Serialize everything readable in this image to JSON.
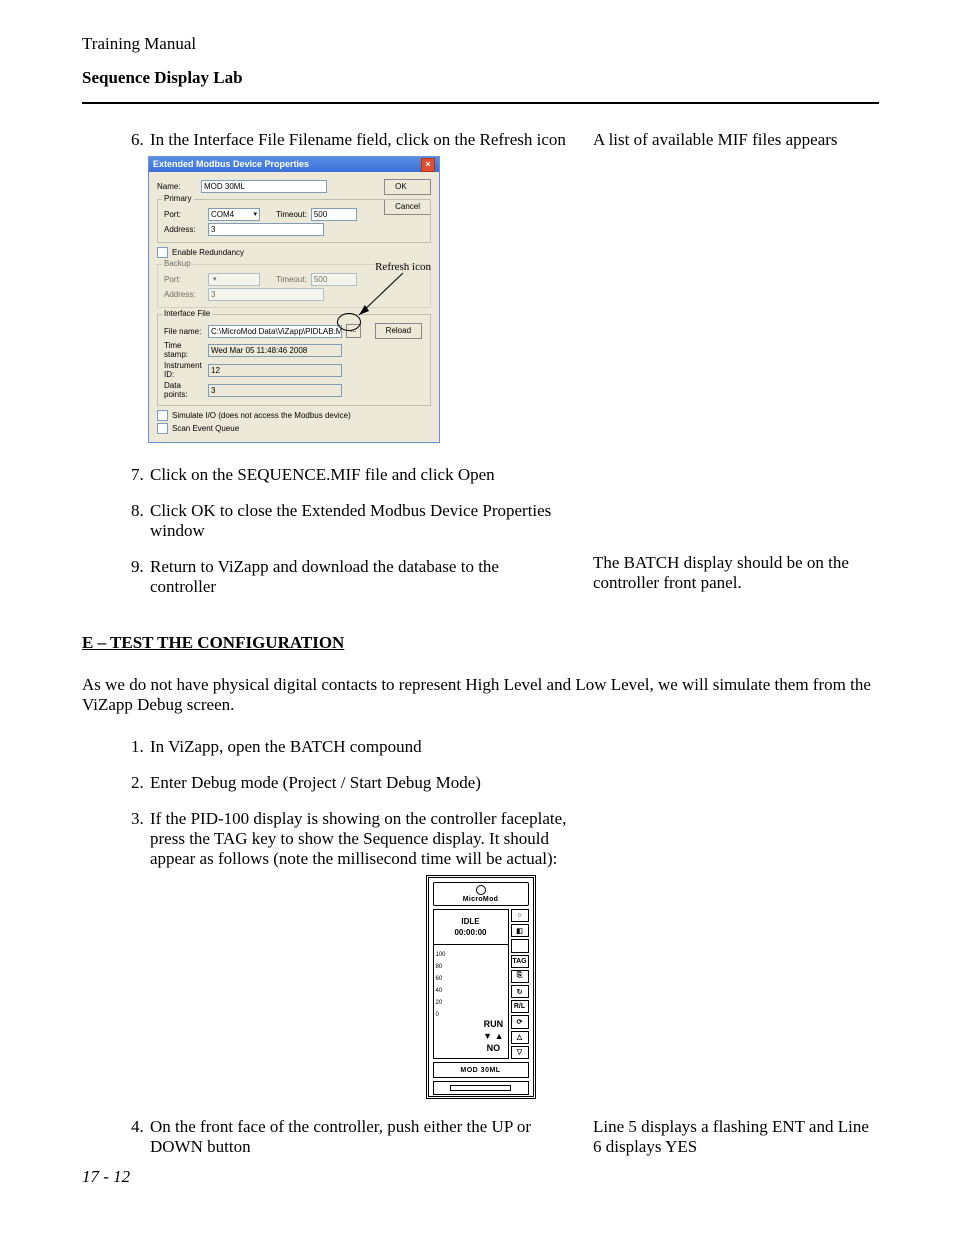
{
  "header": {
    "top": "Training Manual",
    "sub": "Sequence Display Lab"
  },
  "stepsA": {
    "start": 6,
    "items": [
      {
        "t": "In the Interface File Filename field, click on the Refresh icon",
        "r": "A list of available MIF files appears"
      }
    ]
  },
  "dlg": {
    "title": "Extended Modbus Device Properties",
    "ok": "OK",
    "cancel": "Cancel",
    "reload": "Reload",
    "name_lbl": "Name:",
    "name_val": "MOD 30ML",
    "primary": "Primary",
    "port_lbl": "Port:",
    "port_val": "COM4",
    "timeout_lbl": "Timeout:",
    "timeout_val": "500",
    "addr_lbl": "Address:",
    "addr_val": "3",
    "enable_red": "Enable Redundancy",
    "backup": "Backup",
    "backup_port": "",
    "backup_timeout": "500",
    "backup_addr": "3",
    "iface": "Interface File",
    "file_lbl": "File name:",
    "file_val": "C:\\MicroMod Data\\ViZapp\\PIDLAB.MIF",
    "ts_lbl": "Time stamp:",
    "ts_val": "Wed Mar 05 11:48:46 2008",
    "iid_lbl": "Instrument ID:",
    "iid_val": "12",
    "dp_lbl": "Data points:",
    "dp_val": "3",
    "sim": "Simulate I/O (does not access the Modbus device)",
    "scan": "Scan Event Queue",
    "refresh_annot": "Refresh icon"
  },
  "stepsB": {
    "start": 7,
    "items": [
      {
        "t": "Click on the SEQUENCE.MIF file and click Open",
        "r": ""
      },
      {
        "t": "Click OK to close the Extended Modbus Device Properties window",
        "r": ""
      },
      {
        "t": "Return to ViZapp and download the database to the controller",
        "r": "The BATCH display should be on the controller front panel."
      }
    ]
  },
  "sectionE": {
    "head": "E – TEST THE CONFIGURATION",
    "para": "As we do not have physical digital contacts to represent High Level and Low Level, we will simulate them from the ViZapp Debug screen."
  },
  "stepsC": {
    "start": 1,
    "items": [
      {
        "t": "In ViZapp, open the BATCH compound",
        "r": ""
      },
      {
        "t": "Enter Debug mode (Project / Start Debug Mode)",
        "r": ""
      },
      {
        "t": "If the PID-100 display is showing on the controller faceplate, press the TAG key to show the Sequence display.  It should appear as follows (note the millisecond time will be actual):",
        "r": ""
      }
    ]
  },
  "faceplate": {
    "brand": "MicroMod",
    "idle": "IDLE",
    "time": "00:00:00",
    "ticks": [
      "100",
      "80",
      "60",
      "40",
      "20",
      "0"
    ],
    "run": "RUN",
    "arrows": "▼  ▲",
    "no": "NO",
    "keys": [
      "○",
      "◧",
      "",
      "TAG",
      "⎘",
      "↻",
      "R/L",
      "⟳",
      "△",
      "▽"
    ],
    "model": "MOD 30ML"
  },
  "stepsD": {
    "start": 4,
    "items": [
      {
        "t": "On the front face of the controller, push either the UP or DOWN button",
        "r": "Line 5 displays a flashing ENT and Line 6 displays YES"
      }
    ]
  },
  "footer": "17 - 12"
}
